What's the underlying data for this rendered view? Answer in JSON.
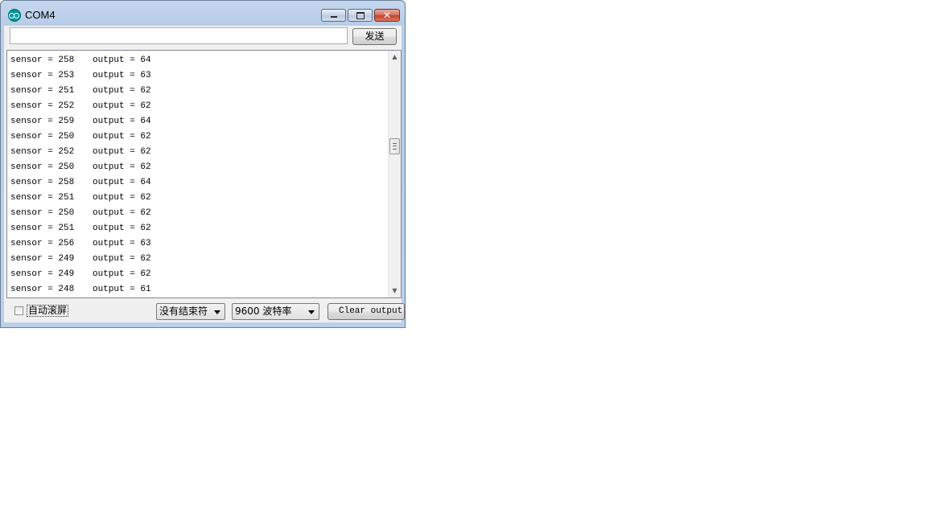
{
  "window": {
    "title": "COM4",
    "icon": "arduino-icon",
    "close_glyph": "✕"
  },
  "send": {
    "input_value": "",
    "button_label": "发送"
  },
  "output": {
    "lines": [
      {
        "sensor": "sensor = 258",
        "output": "output = 64"
      },
      {
        "sensor": "sensor = 253",
        "output": "output = 63"
      },
      {
        "sensor": "sensor = 251",
        "output": "output = 62"
      },
      {
        "sensor": "sensor = 252",
        "output": "output = 62"
      },
      {
        "sensor": "sensor = 259",
        "output": "output = 64"
      },
      {
        "sensor": "sensor = 250",
        "output": "output = 62"
      },
      {
        "sensor": "sensor = 252",
        "output": "output = 62"
      },
      {
        "sensor": "sensor = 250",
        "output": "output = 62"
      },
      {
        "sensor": "sensor = 258",
        "output": "output = 64"
      },
      {
        "sensor": "sensor = 251",
        "output": "output = 62"
      },
      {
        "sensor": "sensor = 250",
        "output": "output = 62"
      },
      {
        "sensor": "sensor = 251",
        "output": "output = 62"
      },
      {
        "sensor": "sensor = 256",
        "output": "output = 63"
      },
      {
        "sensor": "sensor = 249",
        "output": "output = 62"
      },
      {
        "sensor": "sensor = 249",
        "output": "output = 62"
      },
      {
        "sensor": "sensor = 248",
        "output": "output = 61"
      }
    ],
    "scroll_up": "▲",
    "scroll_down": "▼"
  },
  "bottom": {
    "autoscroll_label": "自动滚屏",
    "autoscroll_checked": false,
    "line_ending": "没有结束符",
    "baud_rate": "9600 波特率",
    "clear_label": "Clear output"
  }
}
